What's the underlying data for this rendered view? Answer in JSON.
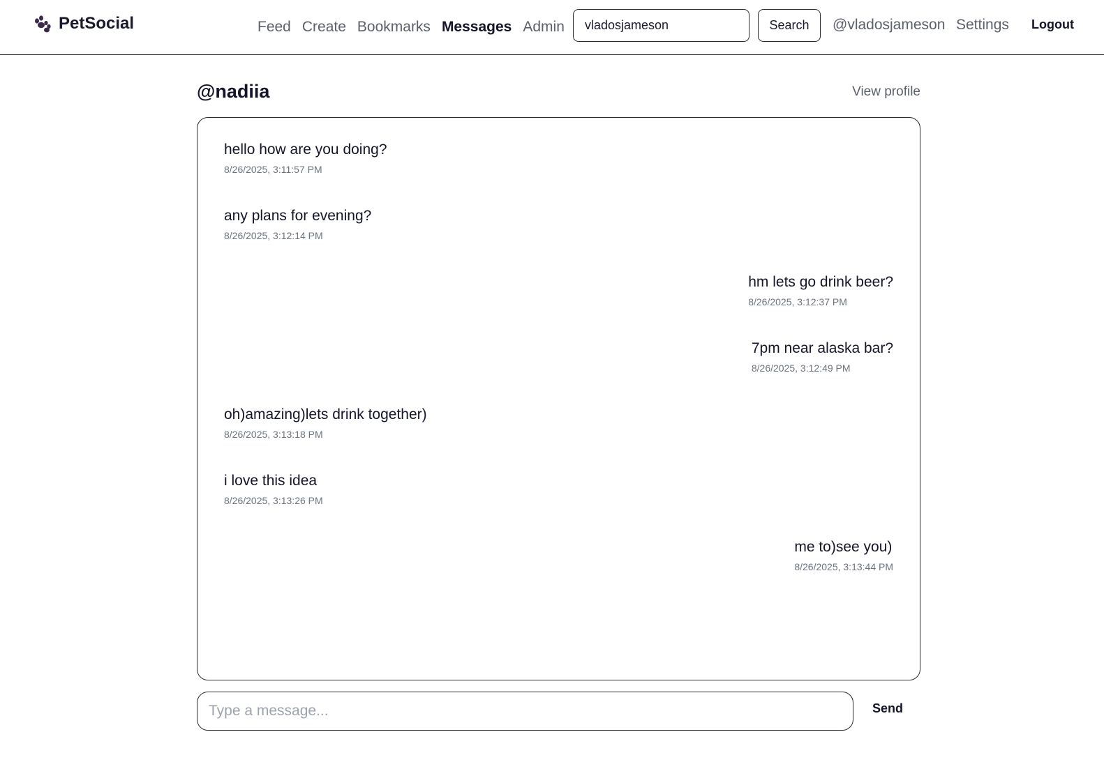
{
  "brand": {
    "name": "PetSocial",
    "icon": "paw-icon",
    "icon_color": "#3b2a4a"
  },
  "nav": {
    "items": [
      {
        "label": "Feed",
        "active": false
      },
      {
        "label": "Create",
        "active": false
      },
      {
        "label": "Bookmarks",
        "active": false
      },
      {
        "label": "Messages",
        "active": true
      },
      {
        "label": "Admin",
        "active": false
      }
    ]
  },
  "search": {
    "value": "vladosjameson",
    "button_label": "Search"
  },
  "user": {
    "handle": "@vladosjameson",
    "settings_label": "Settings",
    "logout_label": "Logout"
  },
  "conversation": {
    "title": "@nadiia",
    "view_profile_label": "View profile",
    "messages": [
      {
        "text": "hello how are you doing?",
        "time": "8/26/2025, 3:11:57 PM",
        "side": "left"
      },
      {
        "text": "any plans for evening?",
        "time": "8/26/2025, 3:12:14 PM",
        "side": "left"
      },
      {
        "text": "hm lets go drink beer?",
        "time": "8/26/2025, 3:12:37 PM",
        "side": "right"
      },
      {
        "text": "7pm near alaska bar?",
        "time": "8/26/2025, 3:12:49 PM",
        "side": "right"
      },
      {
        "text": "oh)amazing)lets drink together)",
        "time": "8/26/2025, 3:13:18 PM",
        "side": "left"
      },
      {
        "text": "i love this idea",
        "time": "8/26/2025, 3:13:26 PM",
        "side": "left"
      },
      {
        "text": "me to)see you)",
        "time": "8/26/2025, 3:13:44 PM",
        "side": "right"
      }
    ]
  },
  "compose": {
    "placeholder": "Type a message...",
    "value": "",
    "send_label": "Send"
  }
}
